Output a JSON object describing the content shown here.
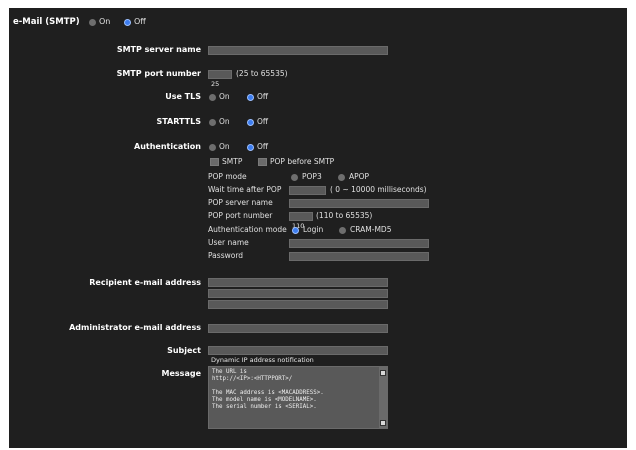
{
  "header": {
    "title": "e-Mail (SMTP)",
    "on_label": "On",
    "off_label": "Off",
    "selected": "Off"
  },
  "smtp_server": {
    "label": "SMTP server name",
    "value": ""
  },
  "smtp_port": {
    "label": "SMTP port number",
    "value": "25",
    "hint": "(25 to 65535)"
  },
  "use_tls": {
    "label": "Use TLS",
    "on_label": "On",
    "off_label": "Off",
    "selected": "Off"
  },
  "starttls": {
    "label": "STARTTLS",
    "on_label": "On",
    "off_label": "Off",
    "selected": "Off"
  },
  "authentication": {
    "label": "Authentication",
    "on_label": "On",
    "off_label": "Off",
    "selected": "Off",
    "smtp_check_label": "SMTP",
    "pop_check_label": "POP before SMTP",
    "pop_mode": {
      "label": "POP mode",
      "options": [
        "POP3",
        "APOP"
      ],
      "selected": "none"
    },
    "wait_time": {
      "label": "Wait time after POP",
      "value": "",
      "hint": "( 0 ~ 10000 milliseconds)"
    },
    "pop_server": {
      "label": "POP server name",
      "value": ""
    },
    "pop_port": {
      "label": "POP port number",
      "value": "110",
      "hint": "(110 to 65535)"
    },
    "auth_mode": {
      "label": "Authentication mode",
      "options": [
        "Login",
        "CRAM-MD5"
      ],
      "selected": "Login"
    },
    "user_name": {
      "label": "User name",
      "value": ""
    },
    "password": {
      "label": "Password",
      "value": ""
    }
  },
  "recipient": {
    "label": "Recipient e-mail address",
    "values": [
      "",
      "",
      ""
    ]
  },
  "administrator": {
    "label": "Administrator e-mail address",
    "value": ""
  },
  "subject": {
    "label": "Subject",
    "value": "Dynamic IP address notification"
  },
  "message": {
    "label": "Message",
    "value": "The URL is\nhttp://<IP>:<HTTPPORT>/\n\nThe MAC address is <MACADDRESS>.\nThe model name is <MODELNAME>.\nThe serial number is <SERIAL>."
  },
  "colors": {
    "panel_bg": "#1f1f1f",
    "field_bg": "#595959",
    "radio_selected": "#3d7df0"
  }
}
